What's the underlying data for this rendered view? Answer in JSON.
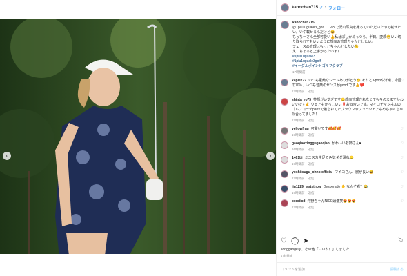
{
  "post": {
    "username": "kanochan715",
    "verified_icon": "verified-badge",
    "follow_label": "フォロー",
    "more_icon": "more-dots-icon"
  },
  "caption": {
    "username": "kanochan715",
    "lines": [
      "@1piu1uguale3_golf コンペで沢山写真を撮っていただいたので載せたい。いや載せるんだけど😆",
      "もっちーさん全部可愛い👍私はぽしかめっつら。半目。変顔😁いい切り取られてもいいように顔面の管理ちゃんとしたい。",
      "フェースの管理はもっとちゃんとしたい🤔",
      "え、ちょっと上手かったいま？",
      "#1piu1uguale3",
      "#1piu1uguale3golf",
      "#イーグルポイントゴルフクラブ"
    ],
    "time": "17時間前"
  },
  "comments": [
    {
      "user": "kapie727",
      "text": "いつも素敵なシーンありがとう😊 それとJ-popや洋楽、今回の70%、いつも音楽のセンスがgood!です👍❤️",
      "time": "17時間前",
      "reply": "返信"
    },
    {
      "user": "shinta_ro75",
      "text": "笑顔がいすぎです😊顔面管理されなくても今のままでかわいいです✌️ ウェアもかっこいい‼️お似合いです。マイコチャンネルのゴルフコーデpart2で着られてたブラウンのワンピウェアもめちゃくちゃ似合ってました！",
      "time": "17時間前",
      "reply": "返信"
    },
    {
      "user": "yellowfrag",
      "text": "可愛いです🥰🥰🥰",
      "time": "17時間前",
      "reply": "返信"
    },
    {
      "user": "gaoqiaoxinggugaoqiao",
      "text": "かわいいお姉さん♥",
      "time": "16時間前",
      "reply": "返信"
    },
    {
      "user": "1461bi",
      "text": "ミニスカ生足で色気ダダ漏れ😊",
      "time": "17時間前",
      "reply": "返信"
    },
    {
      "user": "yoshitsugu_ohno.official",
      "text": "マイコさん、腕が長い😂",
      "time": "17時間前",
      "reply": "返信"
    },
    {
      "user": "jin1229_laststhow",
      "text": "Desperade ✋ なんぞ者？😂",
      "time": "17時間前",
      "reply": "返信"
    },
    {
      "user": "coroiicd",
      "text": "狩野ちゃんNICE頭髄笑😍😍😍",
      "time": "17時間前",
      "reply": "返信"
    }
  ],
  "reply_label": "返信",
  "actions": {
    "like_icon": "heart-icon",
    "comment_icon": "comment-icon",
    "share_icon": "share-icon",
    "save_icon": "bookmark-icon"
  },
  "likes_text": "songgangkuji、その他「いいね！」しました",
  "likes_user": "songgangkuji",
  "post_time": "17時間前",
  "add_comment_placeholder": "コメントを追加...",
  "post_button": "投稿する"
}
